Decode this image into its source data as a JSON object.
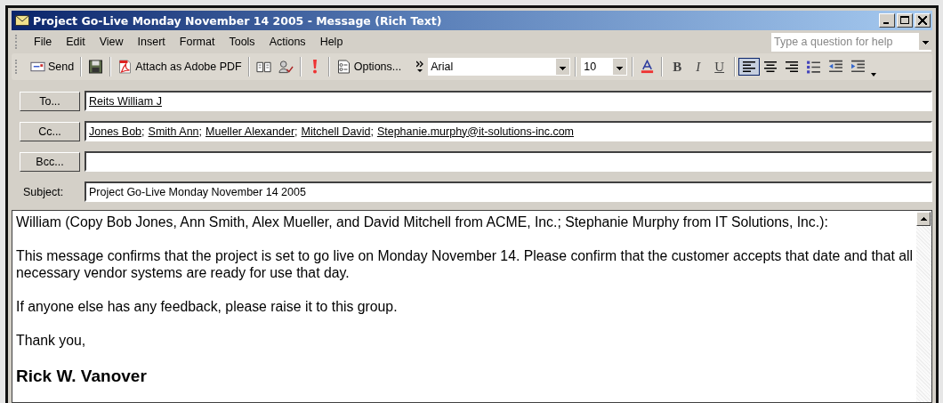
{
  "window": {
    "title": "Project Go-Live Monday November 14 2005 - Message (Rich Text)"
  },
  "menu": [
    "File",
    "Edit",
    "View",
    "Insert",
    "Format",
    "Tools",
    "Actions",
    "Help"
  ],
  "help_box": {
    "placeholder": "Type a question for help"
  },
  "toolbar": [
    {
      "kind": "send",
      "label": "Send"
    },
    {
      "kind": "separator"
    },
    {
      "kind": "save"
    },
    {
      "kind": "separator"
    },
    {
      "kind": "attach",
      "label": "Attach as Adobe PDF"
    },
    {
      "kind": "separator"
    },
    {
      "kind": "addressbook"
    },
    {
      "kind": "checknames"
    },
    {
      "kind": "separator"
    },
    {
      "kind": "importance"
    },
    {
      "kind": "separator"
    },
    {
      "kind": "options",
      "label": "Options..."
    },
    {
      "kind": "chevron"
    },
    {
      "kind": "fontname",
      "value": "Arial"
    },
    {
      "kind": "separator"
    },
    {
      "kind": "fontsize",
      "value": "10"
    },
    {
      "kind": "separator"
    },
    {
      "kind": "fontcolor"
    },
    {
      "kind": "separator"
    },
    {
      "kind": "bold",
      "label": "B"
    },
    {
      "kind": "italic",
      "label": "I"
    },
    {
      "kind": "underline",
      "label": "U"
    },
    {
      "kind": "separator"
    },
    {
      "kind": "alignleft",
      "selected": true
    },
    {
      "kind": "aligncenter",
      "selected": false
    },
    {
      "kind": "alignright",
      "selected": false
    },
    {
      "kind": "bullets"
    },
    {
      "kind": "outdent"
    },
    {
      "kind": "indent"
    },
    {
      "kind": "more"
    }
  ],
  "fields": [
    {
      "kind": "button",
      "label": "To...",
      "recipients": [
        {
          "name": "Reits William J"
        }
      ]
    },
    {
      "kind": "button",
      "label": "Cc...",
      "recipients": [
        {
          "name": "Jones Bob",
          "separator": ";"
        },
        {
          "name": "Smith Ann",
          "separator": ";"
        },
        {
          "name": "Mueller Alexander",
          "separator": ";"
        },
        {
          "name": "Mitchell David",
          "separator": ";"
        },
        {
          "name": "Stephanie.murphy@it-solutions-inc.com"
        }
      ]
    },
    {
      "kind": "button",
      "label": "Bcc..."
    },
    {
      "kind": "label",
      "label": "Subject:",
      "value": "Project Go-Live Monday November 14 2005"
    }
  ],
  "body": [
    {
      "kind": "para",
      "text": "William (Copy Bob Jones, Ann Smith, Alex Mueller, and David Mitchell from ACME, Inc.; Stephanie Murphy from IT Solutions, Inc.):"
    },
    {
      "kind": "para",
      "text": "This message confirms that the project is set to go live on Monday November 14.  Please confirm that the customer accepts that date and that all necessary vendor systems are ready for use that day."
    },
    {
      "kind": "para",
      "text": "If anyone else has any feedback, please raise it to this group."
    },
    {
      "kind": "para",
      "text": "Thank you,"
    },
    {
      "kind": "signature",
      "text": "Rick W. Vanover"
    }
  ]
}
